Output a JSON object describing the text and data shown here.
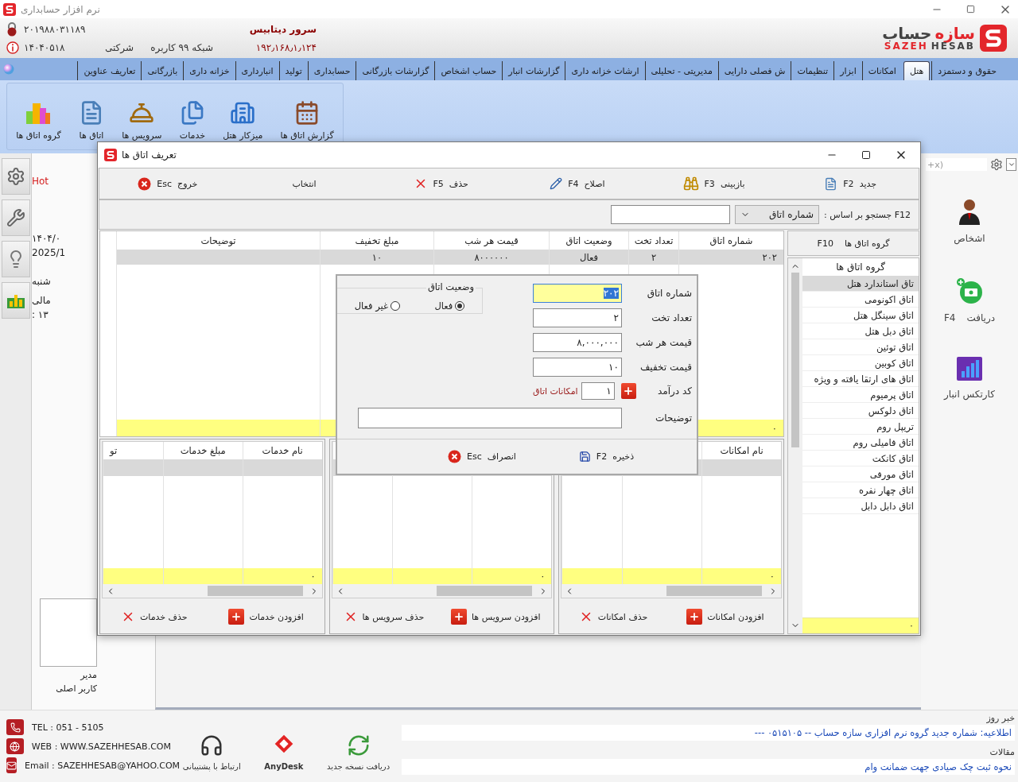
{
  "app": {
    "title": "نرم افزار حسابداری"
  },
  "header": {
    "brand_red": "سازه",
    "brand_dark": "حساب",
    "brand_en_red": "SAZEH",
    "brand_en_dark": "HESAB",
    "server_label": "سرور دیتابیس",
    "server_ip": "۱۹۲٫۱۶۸٫۱٫۱۲۴",
    "serial": "۲۰۱۹۸۸۰۳۱۱۸۹",
    "date_code": "۱۴۰۴۰۵۱۸",
    "license_type": "شرکتی",
    "license_users": "شبکه ۹۹ کاربره"
  },
  "menu_tabs": [
    {
      "label": "حقوق و دستمزد",
      "selected": false
    },
    {
      "label": "هتل",
      "selected": true
    },
    {
      "label": "امکانات",
      "selected": false
    },
    {
      "label": "ابزار",
      "selected": false
    },
    {
      "label": "تنظیمات",
      "selected": false
    },
    {
      "label": "ش فصلی دارایی",
      "selected": false
    },
    {
      "label": "مدیریتی - تحلیلی",
      "selected": false
    },
    {
      "label": "ارشات خزانه داری",
      "selected": false
    },
    {
      "label": "گزارشات انبار",
      "selected": false
    },
    {
      "label": "حساب اشخاص",
      "selected": false
    },
    {
      "label": "گزارشات بازرگانی",
      "selected": false
    },
    {
      "label": "حسابداری",
      "selected": false
    },
    {
      "label": "تولید",
      "selected": false
    },
    {
      "label": "انبارداری",
      "selected": false
    },
    {
      "label": "خزانه داری",
      "selected": false
    },
    {
      "label": "بازرگانی",
      "selected": false
    },
    {
      "label": "تعاریف عناوین",
      "selected": false
    }
  ],
  "ribbon": [
    {
      "label": "گزارش اتاق ها",
      "kind": "report"
    },
    {
      "label": "میزکار هتل",
      "kind": "building"
    },
    {
      "label": "خدمات",
      "kind": "papers"
    },
    {
      "label": "سرویس ها",
      "kind": "bell"
    },
    {
      "label": "اتاق ها",
      "kind": "document"
    },
    {
      "label": "گروه اتاق ها",
      "kind": "buildings"
    }
  ],
  "left_panel": {
    "hotel_text": "Hot",
    "date_fa": "۱۴۰۴/۰",
    "date_en": "2025/1",
    "weekday": "شنبه",
    "fiscal": "مالی",
    "time": "۱۳ :",
    "user_role": "مدیر",
    "user_name": "کاربر اصلی"
  },
  "right_panel": {
    "search_value": "+x)",
    "shortcuts": [
      {
        "label": "اشخاص",
        "kind": "person"
      },
      {
        "label": "دریافت",
        "key": "F4",
        "kind": "receive"
      },
      {
        "label": "کارتکس انبار",
        "kind": "chart"
      }
    ]
  },
  "dialog": {
    "title": "تعریف اتاق ها",
    "toolbar": [
      {
        "label": "جدید",
        "key": "F2",
        "kind": "new"
      },
      {
        "label": "بازبینی",
        "key": "F3",
        "kind": "review"
      },
      {
        "label": "اصلاح",
        "key": "F4",
        "kind": "edit"
      },
      {
        "label": "حذف",
        "key": "F5",
        "kind": "delete"
      },
      {
        "label": "انتخاب",
        "kind": "select"
      },
      {
        "label": "خروج",
        "key": "Esc",
        "kind": "exit"
      }
    ],
    "search": {
      "label": "F12 جستجو بر اساس :",
      "field": "شماره اتاق"
    },
    "groups": {
      "title": "گروه اتاق ها",
      "key": "F10",
      "header": "گروه اتاق ها",
      "footer": "۰",
      "items": [
        {
          "label": "تاق استاندارد هتل",
          "selected": true
        },
        {
          "label": "اتاق اکونومی",
          "selected": false
        },
        {
          "label": "اتاق سینگل هتل",
          "selected": false
        },
        {
          "label": "اتاق دبل هتل",
          "selected": false
        },
        {
          "label": "اتاق توئین",
          "selected": false
        },
        {
          "label": "اتاق کوبین",
          "selected": false
        },
        {
          "label": "اتاق های ارتقا یافته و ویژه",
          "selected": false
        },
        {
          "label": "اتاق پرمیوم",
          "selected": false
        },
        {
          "label": "اتاق دلوکس",
          "selected": false
        },
        {
          "label": "تریپل روم",
          "selected": false
        },
        {
          "label": "اتاق فامیلی روم",
          "selected": false
        },
        {
          "label": "اتاق کانکت",
          "selected": false
        },
        {
          "label": "اتاق مورفی",
          "selected": false
        },
        {
          "label": "اتاق چهار نفره",
          "selected": false
        },
        {
          "label": "اتاق دابل دابل",
          "selected": false
        }
      ]
    },
    "rooms_table": {
      "columns": [
        "شماره اتاق",
        "تعداد تخت",
        "وضعیت اتاق",
        "قیمت هر شب",
        "مبلغ تخفیف",
        "توضیحات"
      ],
      "rows": [
        {
          "cells": [
            "۲۰۲",
            "۲",
            "فعال",
            "۸۰۰۰۰۰۰",
            "۱۰"
          ],
          "selected": true
        }
      ],
      "footer": "۰"
    },
    "sub_tables": [
      {
        "columns": [
          "نام امکانات"
        ],
        "footer": "۰",
        "add": "افزودن امکانات",
        "remove": "حذف امکانات"
      },
      {
        "footer": "۰",
        "add": "افزودن سرویس ها",
        "remove": "حذف سرویس ها"
      },
      {
        "columns": [
          "نام خدمات",
          "مبلغ خدمات",
          "تو"
        ],
        "footer": "۰",
        "add": "افزودن خدمات",
        "remove": "حذف خدمات"
      }
    ],
    "form": {
      "fields": [
        {
          "label": "شماره اتاق",
          "value": "۲۰۲",
          "focused": true
        },
        {
          "label": "تعداد تخت",
          "value": "۲",
          "focused": false
        },
        {
          "label": "قیمت هر شب",
          "value": "۸,۰۰۰,۰۰۰",
          "focused": false
        },
        {
          "label": "قیمت تخفیف",
          "value": "۱۰",
          "focused": false
        }
      ],
      "income": {
        "label": "کد درآمد",
        "value": "۱",
        "link": "امکانات اتاق"
      },
      "notes_label": "توضیحات",
      "status": {
        "label": "وضعیت اتاق",
        "options": [
          {
            "label": "فعال",
            "selected": true
          },
          {
            "label": "غیر فعال",
            "selected": false
          }
        ]
      },
      "buttons": [
        {
          "label": "ذخیره",
          "key": "F2",
          "kind": "save"
        },
        {
          "label": "انصراف",
          "key": "Esc",
          "kind": "cancel"
        }
      ]
    }
  },
  "footer": {
    "contacts": [
      {
        "kind": "phone",
        "text": "TEL : 051 - 5105"
      },
      {
        "kind": "web",
        "text": "WEB : WWW.SAZEHHESAB.COM"
      },
      {
        "kind": "mail",
        "text": "Email : SAZEHHESAB@YAHOO.COM"
      }
    ],
    "actions": [
      {
        "kind": "update",
        "label": "دریافت نسخه جدید"
      },
      {
        "kind": "anydesk",
        "label": "AnyDesk"
      },
      {
        "kind": "support",
        "label": "ارتباط با پشتیبانی"
      }
    ],
    "news_title": "خبر روز",
    "news": "اطلاعیه: شماره جدید گروه نرم افزاری سازه حساب -- ۰۵۱۵۱۰۵ ---",
    "articles_title": "مقالات",
    "article": "نحوه ثبت چک صیادی جهت ضمانت وام"
  }
}
